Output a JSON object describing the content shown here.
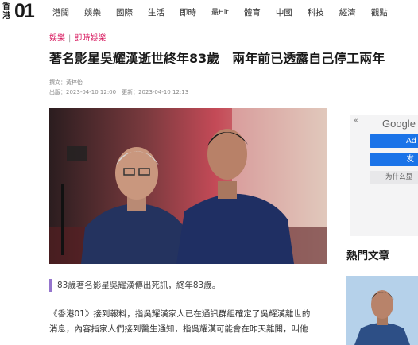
{
  "site": {
    "logo_text": "香港",
    "logo_num": "01"
  },
  "nav": [
    "港聞",
    "娛樂",
    "國際",
    "生活",
    "即時",
    "最Hit",
    "體育",
    "中國",
    "科技",
    "經濟",
    "觀點"
  ],
  "breadcrumb": {
    "section": "娛樂",
    "sub": "即時娛樂"
  },
  "article": {
    "title": "著名影星吳耀漢逝世終年83歲　兩年前已透露自己停工兩年",
    "author": "撰文：黃梓怡",
    "published": "出版：2023-04-10 12:00　更新：2023-04-10 12:13",
    "caption": "83歲著名影星吳耀漢傳出死訊，終年83歲。",
    "body": [
      "《香港01》接到報料，指吳耀漢家人已在通訊群組確定了吳耀漢離世的",
      "消息，內容指家人們接到醫生通知，指吳耀漢可能會在昨天離開，叫他"
    ]
  },
  "ad": {
    "back": "«",
    "brand": "Google",
    "btn1": "Ad",
    "btn2": "发",
    "why": "为什么显"
  },
  "sidebar": {
    "hot_title": "熱門文章"
  },
  "colors": {
    "accent": "#D81B60",
    "brand_blue": "#1E88E5",
    "caption_bar": "#9575CD"
  }
}
